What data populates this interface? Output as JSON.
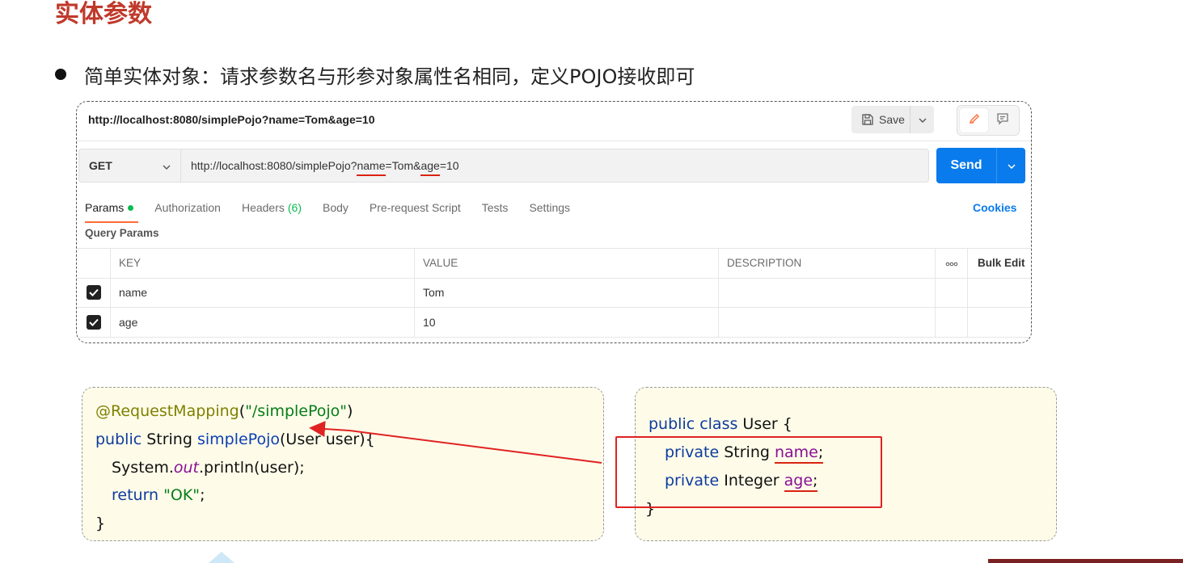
{
  "slide": {
    "title": "实体参数",
    "bullet": "简单实体对象：请求参数名与形参对象属性名相同，定义POJO接收即可"
  },
  "postman": {
    "request_title": "http://localhost:8080/simplePojo?name=Tom&age=10",
    "save_label": "Save",
    "method": "GET",
    "url": {
      "base": "http://localhost:8080/simplePojo?",
      "param1_key": "name",
      "eq1": "=Tom&",
      "param2_key": "age",
      "eq2": "=10"
    },
    "send_label": "Send",
    "tabs": {
      "params": "Params",
      "authorization": "Authorization",
      "headers": "Headers",
      "headers_count": "(6)",
      "body": "Body",
      "prerequest": "Pre-request Script",
      "tests": "Tests",
      "settings": "Settings"
    },
    "cookies_label": "Cookies",
    "query_params_title": "Query Params",
    "table": {
      "headers": {
        "key": "KEY",
        "value": "VALUE",
        "description": "DESCRIPTION",
        "more": "ooo",
        "bulk_edit": "Bulk Edit"
      },
      "rows": [
        {
          "key": "name",
          "value": "Tom",
          "description": "",
          "checked": true
        },
        {
          "key": "age",
          "value": "10",
          "description": "",
          "checked": true
        }
      ]
    }
  },
  "code_left": {
    "l1_ann": "@RequestMapping",
    "l1_open": "(",
    "l1_str": "\"/simplePojo\"",
    "l1_close": ")",
    "l2_kw": "public",
    "l2_type": " String ",
    "l2_fn": "simplePojo",
    "l2_params": "(User user){",
    "l3_obj": "System.",
    "l3_out": "out",
    "l3_call": ".println(user);",
    "l4_kw": "return",
    "l4_sp": " ",
    "l4_str": "\"OK\"",
    "l4_end": ";",
    "l5": "}"
  },
  "code_right": {
    "l1_kw": "public class",
    "l1_rest": " User {",
    "l2_kw": "private",
    "l2_type": " String ",
    "l2_field": "name",
    "l2_end": ";",
    "l3_kw": "private",
    "l3_type": " Integer ",
    "l3_field": "age",
    "l3_end": ";",
    "l4": "}"
  },
  "colors": {
    "title_red": "#c0392b",
    "send_blue": "#097bed",
    "tab_orange": "#ff6c37",
    "params_green": "#0cbb52",
    "annotation_red": "#e02222",
    "code_bg": "#fefce9"
  }
}
